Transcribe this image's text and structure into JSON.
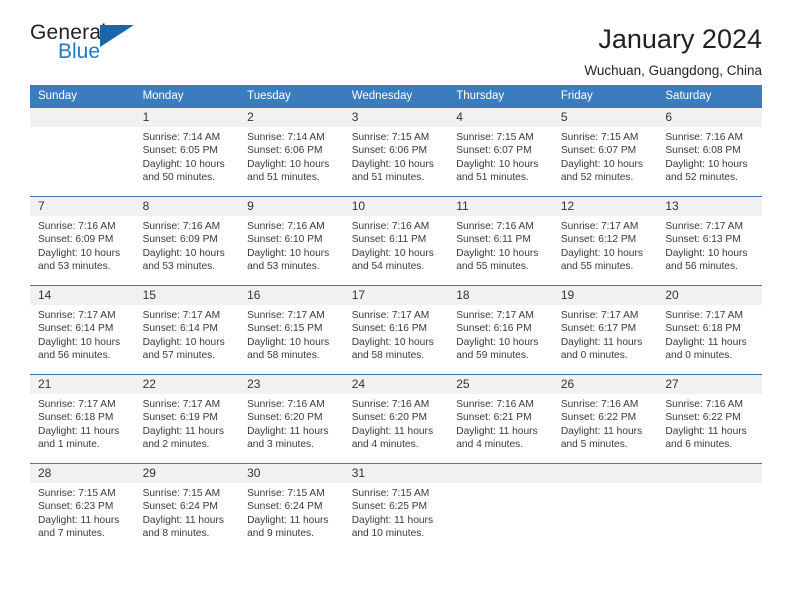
{
  "brand": {
    "name_top": "General",
    "name_bottom": "Blue",
    "accent_color": "#2079c7",
    "flag_color": "#1b65a8"
  },
  "header": {
    "title": "January 2024",
    "subtitle": "Wuchuan, Guangdong, China"
  },
  "theme": {
    "header_row_color": "#3b7cbf",
    "daynum_bg": "#f1f1f1",
    "text_color": "#3a3a3a"
  },
  "weekday_headers": [
    "Sunday",
    "Monday",
    "Tuesday",
    "Wednesday",
    "Thursday",
    "Friday",
    "Saturday"
  ],
  "weeks": [
    [
      {
        "day": "",
        "sunrise": "",
        "sunset": "",
        "daylight1": "",
        "daylight2": ""
      },
      {
        "day": "1",
        "sunrise": "Sunrise: 7:14 AM",
        "sunset": "Sunset: 6:05 PM",
        "daylight1": "Daylight: 10 hours",
        "daylight2": "and 50 minutes."
      },
      {
        "day": "2",
        "sunrise": "Sunrise: 7:14 AM",
        "sunset": "Sunset: 6:06 PM",
        "daylight1": "Daylight: 10 hours",
        "daylight2": "and 51 minutes."
      },
      {
        "day": "3",
        "sunrise": "Sunrise: 7:15 AM",
        "sunset": "Sunset: 6:06 PM",
        "daylight1": "Daylight: 10 hours",
        "daylight2": "and 51 minutes."
      },
      {
        "day": "4",
        "sunrise": "Sunrise: 7:15 AM",
        "sunset": "Sunset: 6:07 PM",
        "daylight1": "Daylight: 10 hours",
        "daylight2": "and 51 minutes."
      },
      {
        "day": "5",
        "sunrise": "Sunrise: 7:15 AM",
        "sunset": "Sunset: 6:07 PM",
        "daylight1": "Daylight: 10 hours",
        "daylight2": "and 52 minutes."
      },
      {
        "day": "6",
        "sunrise": "Sunrise: 7:16 AM",
        "sunset": "Sunset: 6:08 PM",
        "daylight1": "Daylight: 10 hours",
        "daylight2": "and 52 minutes."
      }
    ],
    [
      {
        "day": "7",
        "sunrise": "Sunrise: 7:16 AM",
        "sunset": "Sunset: 6:09 PM",
        "daylight1": "Daylight: 10 hours",
        "daylight2": "and 53 minutes."
      },
      {
        "day": "8",
        "sunrise": "Sunrise: 7:16 AM",
        "sunset": "Sunset: 6:09 PM",
        "daylight1": "Daylight: 10 hours",
        "daylight2": "and 53 minutes."
      },
      {
        "day": "9",
        "sunrise": "Sunrise: 7:16 AM",
        "sunset": "Sunset: 6:10 PM",
        "daylight1": "Daylight: 10 hours",
        "daylight2": "and 53 minutes."
      },
      {
        "day": "10",
        "sunrise": "Sunrise: 7:16 AM",
        "sunset": "Sunset: 6:11 PM",
        "daylight1": "Daylight: 10 hours",
        "daylight2": "and 54 minutes."
      },
      {
        "day": "11",
        "sunrise": "Sunrise: 7:16 AM",
        "sunset": "Sunset: 6:11 PM",
        "daylight1": "Daylight: 10 hours",
        "daylight2": "and 55 minutes."
      },
      {
        "day": "12",
        "sunrise": "Sunrise: 7:17 AM",
        "sunset": "Sunset: 6:12 PM",
        "daylight1": "Daylight: 10 hours",
        "daylight2": "and 55 minutes."
      },
      {
        "day": "13",
        "sunrise": "Sunrise: 7:17 AM",
        "sunset": "Sunset: 6:13 PM",
        "daylight1": "Daylight: 10 hours",
        "daylight2": "and 56 minutes."
      }
    ],
    [
      {
        "day": "14",
        "sunrise": "Sunrise: 7:17 AM",
        "sunset": "Sunset: 6:14 PM",
        "daylight1": "Daylight: 10 hours",
        "daylight2": "and 56 minutes."
      },
      {
        "day": "15",
        "sunrise": "Sunrise: 7:17 AM",
        "sunset": "Sunset: 6:14 PM",
        "daylight1": "Daylight: 10 hours",
        "daylight2": "and 57 minutes."
      },
      {
        "day": "16",
        "sunrise": "Sunrise: 7:17 AM",
        "sunset": "Sunset: 6:15 PM",
        "daylight1": "Daylight: 10 hours",
        "daylight2": "and 58 minutes."
      },
      {
        "day": "17",
        "sunrise": "Sunrise: 7:17 AM",
        "sunset": "Sunset: 6:16 PM",
        "daylight1": "Daylight: 10 hours",
        "daylight2": "and 58 minutes."
      },
      {
        "day": "18",
        "sunrise": "Sunrise: 7:17 AM",
        "sunset": "Sunset: 6:16 PM",
        "daylight1": "Daylight: 10 hours",
        "daylight2": "and 59 minutes."
      },
      {
        "day": "19",
        "sunrise": "Sunrise: 7:17 AM",
        "sunset": "Sunset: 6:17 PM",
        "daylight1": "Daylight: 11 hours",
        "daylight2": "and 0 minutes."
      },
      {
        "day": "20",
        "sunrise": "Sunrise: 7:17 AM",
        "sunset": "Sunset: 6:18 PM",
        "daylight1": "Daylight: 11 hours",
        "daylight2": "and 0 minutes."
      }
    ],
    [
      {
        "day": "21",
        "sunrise": "Sunrise: 7:17 AM",
        "sunset": "Sunset: 6:18 PM",
        "daylight1": "Daylight: 11 hours",
        "daylight2": "and 1 minute."
      },
      {
        "day": "22",
        "sunrise": "Sunrise: 7:17 AM",
        "sunset": "Sunset: 6:19 PM",
        "daylight1": "Daylight: 11 hours",
        "daylight2": "and 2 minutes."
      },
      {
        "day": "23",
        "sunrise": "Sunrise: 7:16 AM",
        "sunset": "Sunset: 6:20 PM",
        "daylight1": "Daylight: 11 hours",
        "daylight2": "and 3 minutes."
      },
      {
        "day": "24",
        "sunrise": "Sunrise: 7:16 AM",
        "sunset": "Sunset: 6:20 PM",
        "daylight1": "Daylight: 11 hours",
        "daylight2": "and 4 minutes."
      },
      {
        "day": "25",
        "sunrise": "Sunrise: 7:16 AM",
        "sunset": "Sunset: 6:21 PM",
        "daylight1": "Daylight: 11 hours",
        "daylight2": "and 4 minutes."
      },
      {
        "day": "26",
        "sunrise": "Sunrise: 7:16 AM",
        "sunset": "Sunset: 6:22 PM",
        "daylight1": "Daylight: 11 hours",
        "daylight2": "and 5 minutes."
      },
      {
        "day": "27",
        "sunrise": "Sunrise: 7:16 AM",
        "sunset": "Sunset: 6:22 PM",
        "daylight1": "Daylight: 11 hours",
        "daylight2": "and 6 minutes."
      }
    ],
    [
      {
        "day": "28",
        "sunrise": "Sunrise: 7:15 AM",
        "sunset": "Sunset: 6:23 PM",
        "daylight1": "Daylight: 11 hours",
        "daylight2": "and 7 minutes."
      },
      {
        "day": "29",
        "sunrise": "Sunrise: 7:15 AM",
        "sunset": "Sunset: 6:24 PM",
        "daylight1": "Daylight: 11 hours",
        "daylight2": "and 8 minutes."
      },
      {
        "day": "30",
        "sunrise": "Sunrise: 7:15 AM",
        "sunset": "Sunset: 6:24 PM",
        "daylight1": "Daylight: 11 hours",
        "daylight2": "and 9 minutes."
      },
      {
        "day": "31",
        "sunrise": "Sunrise: 7:15 AM",
        "sunset": "Sunset: 6:25 PM",
        "daylight1": "Daylight: 11 hours",
        "daylight2": "and 10 minutes."
      },
      {
        "day": "",
        "sunrise": "",
        "sunset": "",
        "daylight1": "",
        "daylight2": ""
      },
      {
        "day": "",
        "sunrise": "",
        "sunset": "",
        "daylight1": "",
        "daylight2": ""
      },
      {
        "day": "",
        "sunrise": "",
        "sunset": "",
        "daylight1": "",
        "daylight2": ""
      }
    ]
  ]
}
